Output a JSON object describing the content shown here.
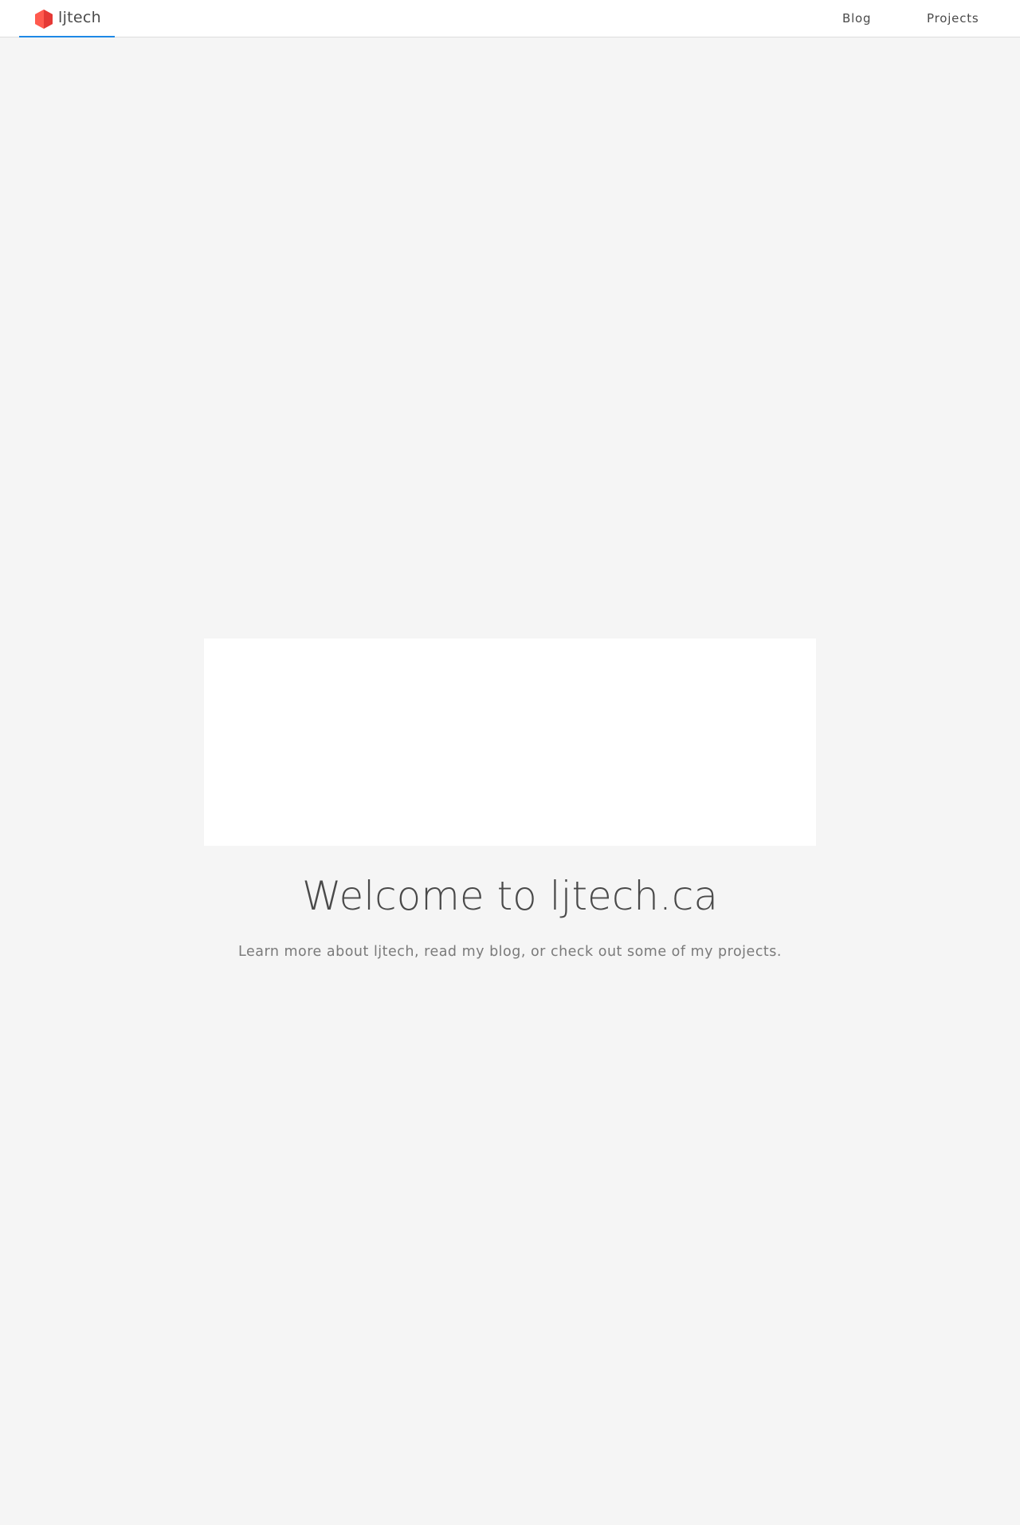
{
  "navbar": {
    "brand": {
      "name": "ljtech",
      "logo_icon": "red-hexagon-logo-icon",
      "logo_color": "#f44336"
    },
    "links": [
      {
        "label": "Blog"
      },
      {
        "label": "Projects"
      }
    ],
    "active_indicator_color": "#1e88e5"
  },
  "hero": {
    "title": "Welcome to ljtech.ca",
    "subtitle": "Learn more about ljtech, read my blog, or check out some of my projects."
  },
  "colors": {
    "page_background": "#f5f5f5",
    "text_primary": "#4a4a4a",
    "text_secondary": "#7a7a7a"
  }
}
